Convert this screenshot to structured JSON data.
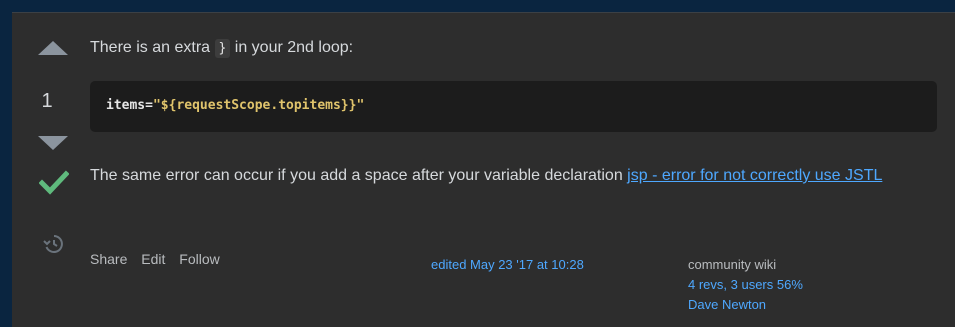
{
  "vote": {
    "count": "1"
  },
  "answer": {
    "intro_before": "There is an extra ",
    "inline_code": "}",
    "intro_after": " in your 2nd loop:",
    "code": {
      "attr": "items",
      "eq": "=",
      "value": "\"${requestScope.topitems}}\""
    },
    "paragraph_text": "The same error can occur if you add a space after your variable declaration ",
    "link_text": "jsp - error for not correctly use JSTL"
  },
  "post_menu": {
    "share": "Share",
    "edit": "Edit",
    "follow": "Follow"
  },
  "edited": {
    "text": "edited May 23 '17 at 10:28"
  },
  "community": {
    "label": "community wiki",
    "revs": "4 revs, 3 users 56%",
    "author": "Dave Newton"
  },
  "colors": {
    "accepted": "#5fba7d",
    "link": "#4ea8ff",
    "background": "#2d2d2d"
  },
  "icons": [
    "upvote-arrow-icon",
    "downvote-arrow-icon",
    "accepted-check-icon",
    "history-icon"
  ]
}
